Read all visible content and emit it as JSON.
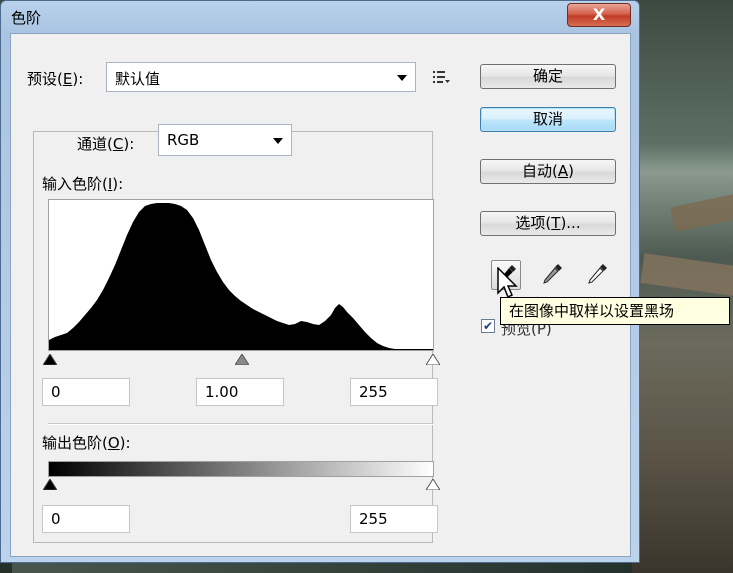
{
  "window": {
    "title": "色阶",
    "close_label": "X"
  },
  "preset": {
    "label_prefix": "预设(",
    "label_key": "E",
    "label_suffix": "):",
    "value": "默认值",
    "menu_icon": "list-menu-icon"
  },
  "channel": {
    "label_prefix": "通道(",
    "label_key": "C",
    "label_suffix": "):",
    "value": "RGB"
  },
  "input_levels": {
    "label_prefix": "输入色阶(",
    "label_key": "I",
    "label_suffix": "):",
    "black": "0",
    "gamma": "1.00",
    "white": "255"
  },
  "output_levels": {
    "label_prefix": "输出色阶(",
    "label_key": "O",
    "label_suffix": "):",
    "black": "0",
    "white": "255"
  },
  "buttons": {
    "ok": "确定",
    "cancel": "取消",
    "auto_prefix": "自动(",
    "auto_key": "A",
    "auto_suffix": ")",
    "options_prefix": "选项(",
    "options_key": "T",
    "options_suffix": ")..."
  },
  "eyedroppers": [
    "black-eyedropper-icon",
    "gray-eyedropper-icon",
    "white-eyedropper-icon"
  ],
  "preview": {
    "checked": true,
    "label": "预览(P)"
  },
  "tooltip": "在图像中取样以设置黑场",
  "colors": {
    "histogram_fill": "#000000",
    "title_bar": "#b9d1ea",
    "close_button": "#c23c25",
    "tooltip_bg": "#ffffe1"
  }
}
